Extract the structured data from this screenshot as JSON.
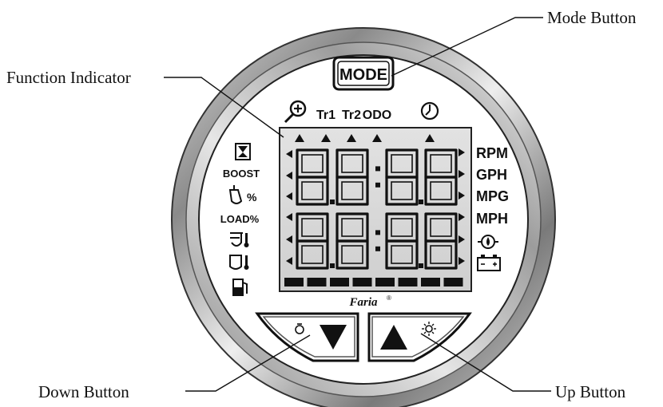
{
  "callouts": {
    "mode_button": "Mode Button",
    "function_indicator": "Function Indicator",
    "down_button": "Down Button",
    "up_button": "Up Button"
  },
  "gauge": {
    "mode_label": "MODE",
    "top_labels": [
      "Tr1",
      "Tr2",
      "ODO"
    ],
    "left_labels": [
      "BOOST",
      "%",
      "LOAD%"
    ],
    "right_labels": [
      "RPM",
      "GPH",
      "MPG",
      "MPH"
    ],
    "brand": "Faria",
    "brand_mark": "®"
  },
  "icons": {
    "top": [
      "zoom-in-icon",
      "clock-icon"
    ],
    "left": [
      "hourglass-icon",
      "fuel-flow-icon",
      "boost-temp-icon",
      "oil-temp-icon",
      "fuel-pump-icon"
    ],
    "right": [
      "oil-pressure-icon",
      "battery-icon"
    ],
    "buttons": [
      "light-bulb-icon",
      "sun-icon"
    ]
  },
  "colors": {
    "bezel_dark": "#6f6f6f",
    "bezel_light": "#f2f2f2",
    "lcd": "#d9d9d9",
    "ink": "#111111"
  }
}
